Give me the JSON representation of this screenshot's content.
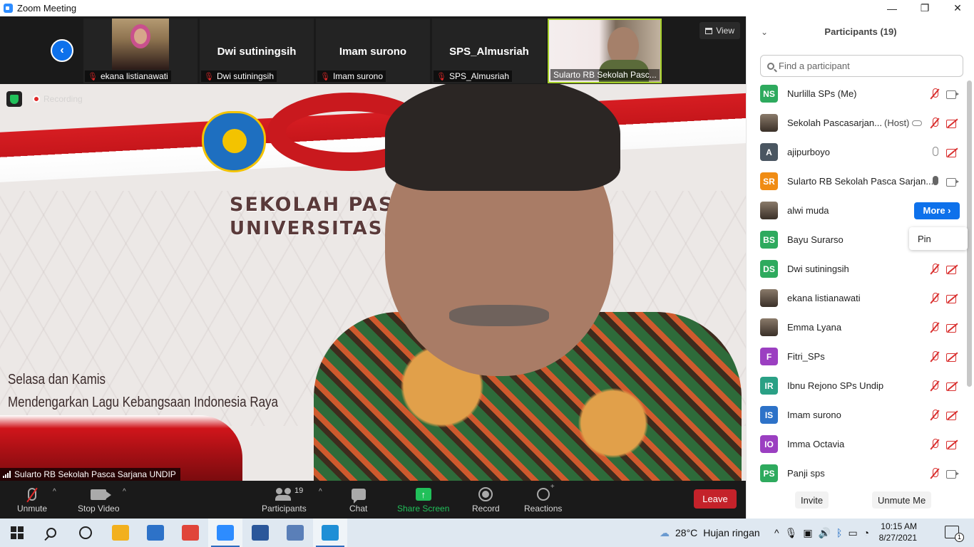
{
  "window": {
    "title": "Zoom Meeting",
    "controls": {
      "minimize": "—",
      "restore": "❐",
      "close": "✕"
    }
  },
  "thumbnails": [
    {
      "name": "ekana listianawati",
      "display": "photo",
      "mic": "muted"
    },
    {
      "name": "Dwi sutiningsih",
      "display": "name",
      "mic": "muted"
    },
    {
      "name": "Imam surono",
      "display": "name",
      "mic": "muted"
    },
    {
      "name": "SPS_Almusriah",
      "display": "name",
      "mic": "muted"
    },
    {
      "name": "Sularto RB Sekolah Pasc...",
      "display": "photo",
      "active": true
    }
  ],
  "view_button": "View",
  "main_video": {
    "speaker_label": "Sularto RB Sekolah Pasca Sarjana UNDIP",
    "recording_label": "Recording",
    "background_text": {
      "line1": "SEKOLAH PAS",
      "line2": "UNIVERSITAS",
      "caption1": "Selasa dan Kamis",
      "caption2": "Mendengarkan Lagu Kebangsaan Indonesia Raya"
    }
  },
  "toolbar": {
    "unmute": "Unmute",
    "stop_video": "Stop Video",
    "participants": "Participants",
    "participants_count": "19",
    "chat": "Chat",
    "share_screen": "Share Screen",
    "record": "Record",
    "reactions": "Reactions",
    "leave": "Leave"
  },
  "panel": {
    "title": "Participants (19)",
    "search_placeholder": "Find a participant",
    "participants": [
      {
        "initials": "NS",
        "name": "Nurlilla SPs (Me)",
        "color": "#2eaa5e",
        "mic": "muted",
        "cam": "on"
      },
      {
        "initials": "",
        "name": "Sekolah Pascasarjan...",
        "tag": "(Host)",
        "photo": true,
        "mic": "muted",
        "cam": "off"
      },
      {
        "initials": "A",
        "name": "ajipurboyo",
        "color": "#4a5661",
        "mic": "on",
        "cam": "off"
      },
      {
        "initials": "SR",
        "name": "Sularto RB Sekolah Pasca Sarjan...",
        "color": "#f08c14",
        "mic": "on-dark",
        "cam": "on"
      },
      {
        "initials": "",
        "name": "alwi muda",
        "photo": true,
        "more": "More ›"
      },
      {
        "initials": "BS",
        "name": "Bayu Surarso",
        "color": "#2eaa5e"
      },
      {
        "initials": "DS",
        "name": "Dwi sutiningsih",
        "color": "#2eaa5e",
        "mic": "muted",
        "cam": "off"
      },
      {
        "initials": "",
        "name": "ekana listianawati",
        "photo": true,
        "mic": "muted",
        "cam": "off"
      },
      {
        "initials": "",
        "name": "Emma Lyana",
        "photo": true,
        "mic": "muted",
        "cam": "off"
      },
      {
        "initials": "F",
        "name": "Fitri_SPs",
        "color": "#9b3fc1",
        "mic": "muted",
        "cam": "off"
      },
      {
        "initials": "IR",
        "name": "Ibnu Rejono SPs Undip",
        "color": "#2aa085",
        "mic": "muted",
        "cam": "off"
      },
      {
        "initials": "IS",
        "name": "Imam surono",
        "color": "#2d72c8",
        "mic": "muted",
        "cam": "off"
      },
      {
        "initials": "IO",
        "name": "Imma Octavia",
        "color": "#9b3fc1",
        "mic": "muted",
        "cam": "off"
      },
      {
        "initials": "PS",
        "name": "Panji sps",
        "color": "#2eaa5e",
        "mic": "muted",
        "cam": "on"
      }
    ],
    "pin_popup": "Pin",
    "invite": "Invite",
    "unmute_me": "Unmute Me"
  },
  "taskbar": {
    "weather_temp": "28°C",
    "weather_text": "Hujan ringan",
    "time": "10:15 AM",
    "date": "8/27/2021",
    "notifications": "1",
    "apps": [
      {
        "name": "file-explorer",
        "color": "#f2b01e"
      },
      {
        "name": "mail",
        "color": "#2d72c8"
      },
      {
        "name": "chrome",
        "color": "#e0453a"
      },
      {
        "name": "zoom",
        "color": "#2d8cff"
      },
      {
        "name": "word",
        "color": "#2b579a"
      },
      {
        "name": "app",
        "color": "#5a7fb8"
      },
      {
        "name": "app-active",
        "color": "#1f8fd6"
      }
    ]
  }
}
